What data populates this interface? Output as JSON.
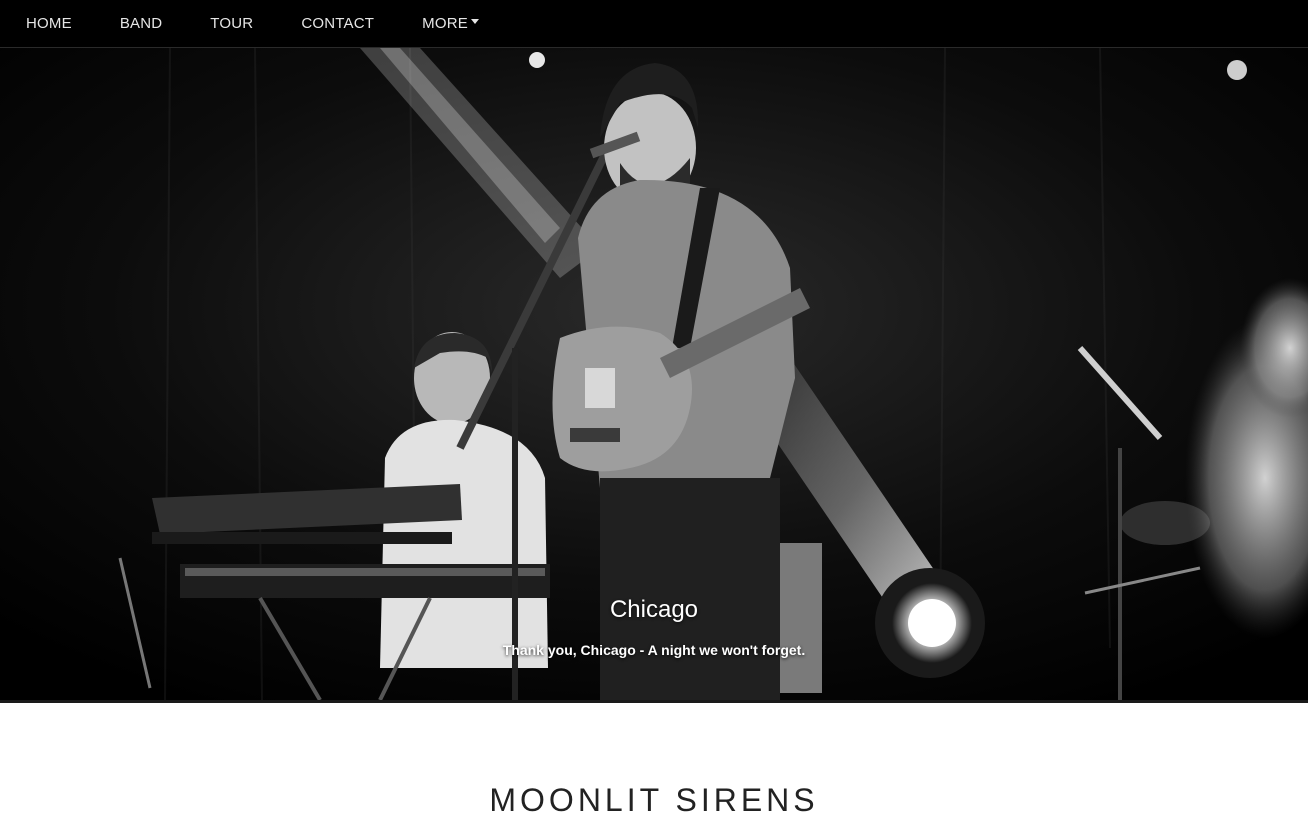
{
  "nav": {
    "items": [
      {
        "label": "HOME"
      },
      {
        "label": "BAND"
      },
      {
        "label": "TOUR"
      },
      {
        "label": "CONTACT"
      },
      {
        "label": "MORE"
      }
    ]
  },
  "hero": {
    "caption_title": "Chicago",
    "caption_text": "Thank you, Chicago - A night we won't forget."
  },
  "section": {
    "title": "MOONLIT SIRENS"
  },
  "colors": {
    "navbar_bg": "#000000",
    "nav_text": "#e6e6e6",
    "hero_bg": "#050505",
    "caption_text": "#ffffff",
    "title_text": "#222222"
  }
}
